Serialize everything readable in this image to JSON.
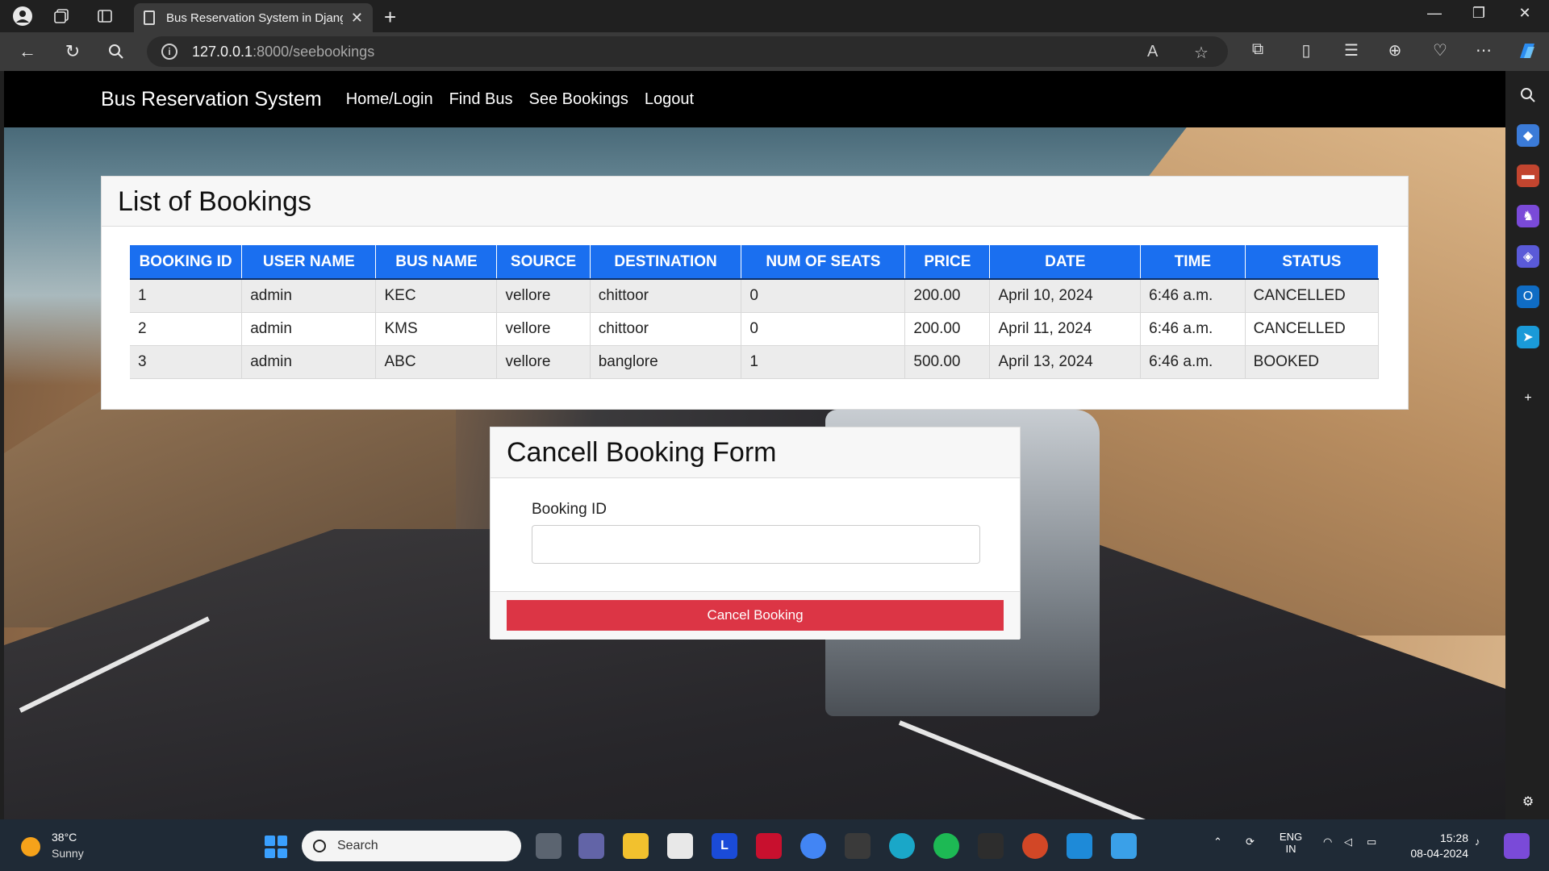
{
  "browser": {
    "tab_title": "Bus Reservation System in Djang",
    "url_host": "127.0.0.1",
    "url_rest": ":8000/seebookings"
  },
  "app": {
    "brand": "Bus Reservation System",
    "nav": [
      {
        "label": "Home/Login"
      },
      {
        "label": "Find Bus"
      },
      {
        "label": "See Bookings"
      },
      {
        "label": "Logout"
      }
    ]
  },
  "bookings": {
    "title": "List of Bookings",
    "columns": [
      "BOOKING ID",
      "USER NAME",
      "BUS NAME",
      "SOURCE",
      "DESTINATION",
      "NUM OF SEATS",
      "PRICE",
      "DATE",
      "TIME",
      "STATUS"
    ],
    "rows": [
      [
        "1",
        "admin",
        "KEC",
        "vellore",
        "chittoor",
        "0",
        "200.00",
        "April 10, 2024",
        "6:46 a.m.",
        "CANCELLED"
      ],
      [
        "2",
        "admin",
        "KMS",
        "vellore",
        "chittoor",
        "0",
        "200.00",
        "April 11, 2024",
        "6:46 a.m.",
        "CANCELLED"
      ],
      [
        "3",
        "admin",
        "ABC",
        "vellore",
        "banglore",
        "1",
        "500.00",
        "April 13, 2024",
        "6:46 a.m.",
        "BOOKED"
      ]
    ]
  },
  "cancel_form": {
    "title": "Cancell Booking Form",
    "field_label": "Booking ID",
    "field_value": "",
    "button_label": "Cancel Booking"
  },
  "taskbar": {
    "temp": "38°C",
    "weather": "Sunny",
    "search_placeholder": "Search",
    "lang_top": "ENG",
    "lang_bottom": "IN",
    "time": "15:28",
    "date": "08-04-2024"
  },
  "colors": {
    "table_header": "#1a6ff0",
    "cancel_button": "#dc3545",
    "navbar": "#000000"
  }
}
